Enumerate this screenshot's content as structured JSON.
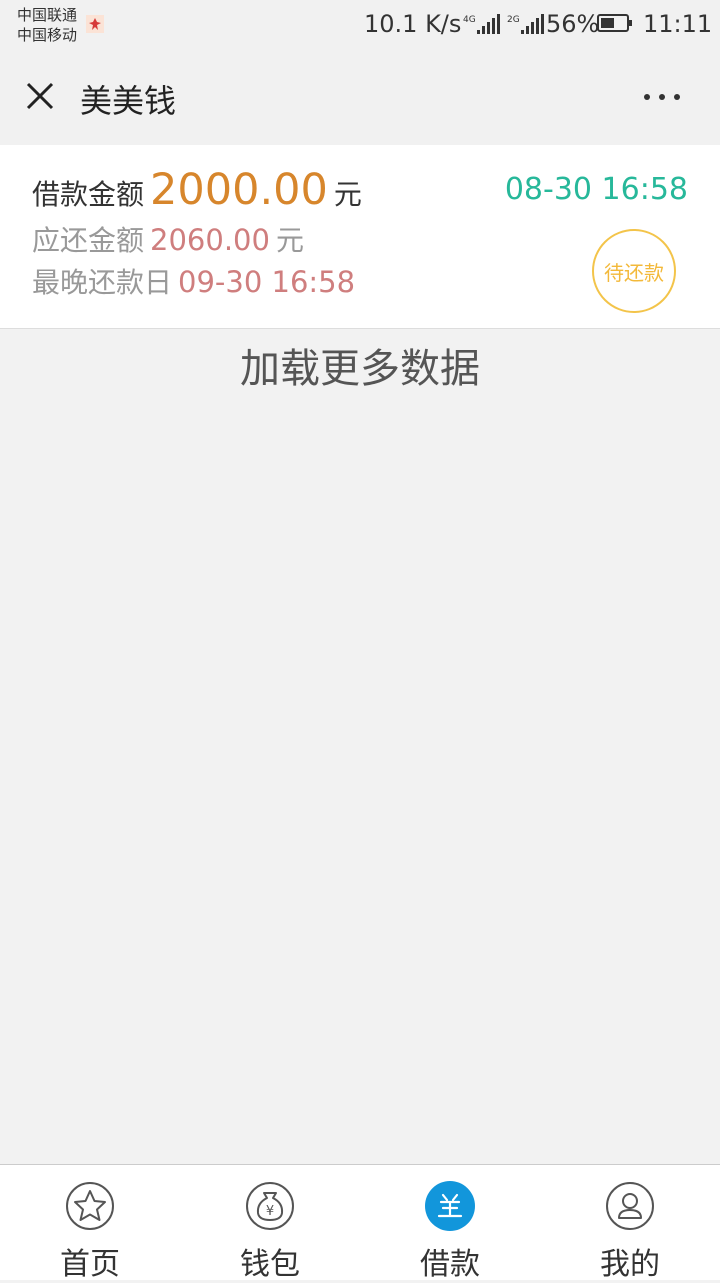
{
  "status_bar": {
    "carrier_1": "中国联通",
    "carrier_2": "中国移动",
    "network_speed": "10.1 K/s",
    "signal_1_type": "4G",
    "signal_2_type": "2G",
    "battery_percent": "56%",
    "battery_level": 0.56,
    "time": "11:11"
  },
  "nav": {
    "title": "美美钱",
    "close_icon": "close-icon",
    "more_icon": "more-dots-icon"
  },
  "loan": {
    "amount_label": "借款金额",
    "amount": "2000.00",
    "amount_unit": "元",
    "loan_time": "08-30 16:58",
    "repay_label": "应还金额",
    "repay_amount": "2060.00",
    "repay_unit": "元",
    "due_label": "最晚还款日",
    "due_date": "09-30 16:58",
    "status": "待还款"
  },
  "load_more": "加载更多数据",
  "tabs": [
    {
      "label": "首页",
      "icon": "star-icon",
      "active": false
    },
    {
      "label": "钱包",
      "icon": "money-bag-icon",
      "active": false
    },
    {
      "label": "借款",
      "icon": "loan-icon",
      "active": true
    },
    {
      "label": "我的",
      "icon": "person-icon",
      "active": false
    }
  ],
  "colors": {
    "accent_blue": "#1296db",
    "amount_orange": "#d7862c",
    "time_green": "#27b89a",
    "badge_yellow": "#f3c44a",
    "value_red": "#cf7e7e"
  }
}
